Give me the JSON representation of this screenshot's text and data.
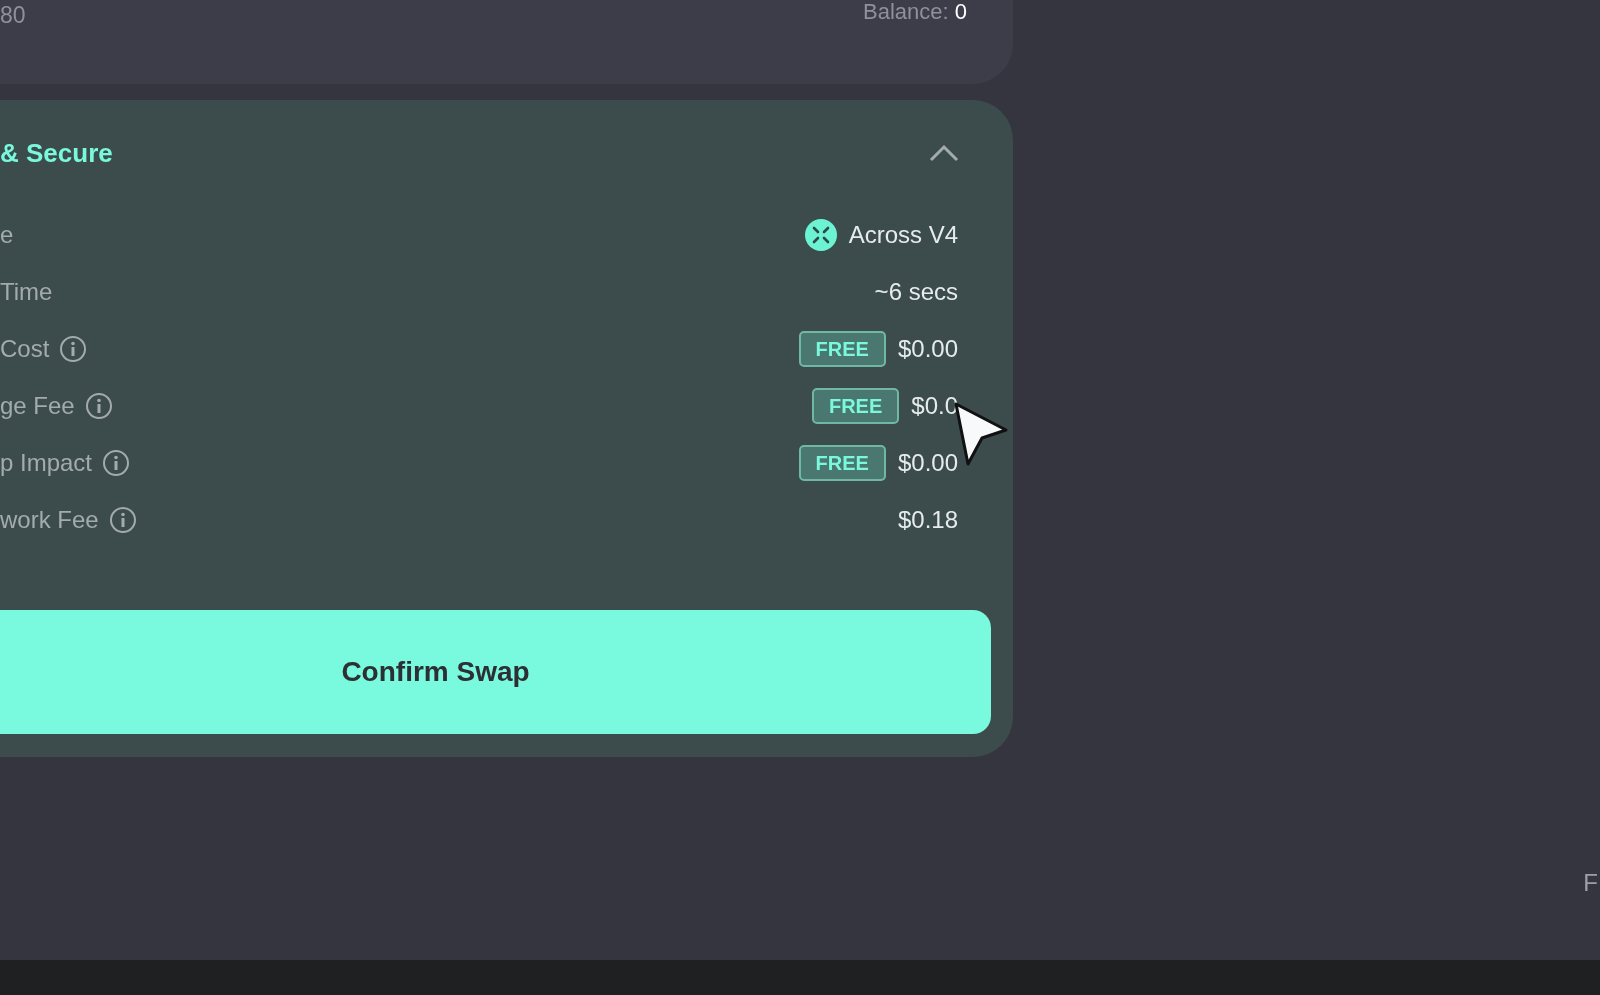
{
  "balance_card": {
    "amount": "80",
    "balance_label": "Balance:",
    "balance_value": "0"
  },
  "details": {
    "title": "& Secure",
    "expanded": true,
    "rows": [
      {
        "kind": "provider",
        "label": "e",
        "info": false,
        "value": "Across V4"
      },
      {
        "kind": "plain",
        "label": "Time",
        "info": false,
        "value": "~6 secs"
      },
      {
        "kind": "fee",
        "label": "Cost",
        "info": true,
        "badge": "FREE",
        "value": "$0.00"
      },
      {
        "kind": "fee",
        "label": "ge Fee",
        "info": true,
        "badge": "FREE",
        "value": "$0.0"
      },
      {
        "kind": "fee",
        "label": "p Impact",
        "info": true,
        "badge": "FREE",
        "value": "$0.00"
      },
      {
        "kind": "plain",
        "label": "work Fee",
        "info": true,
        "value": "$0.18"
      }
    ]
  },
  "confirm_button": "Confirm Swap",
  "footer_text": "F"
}
